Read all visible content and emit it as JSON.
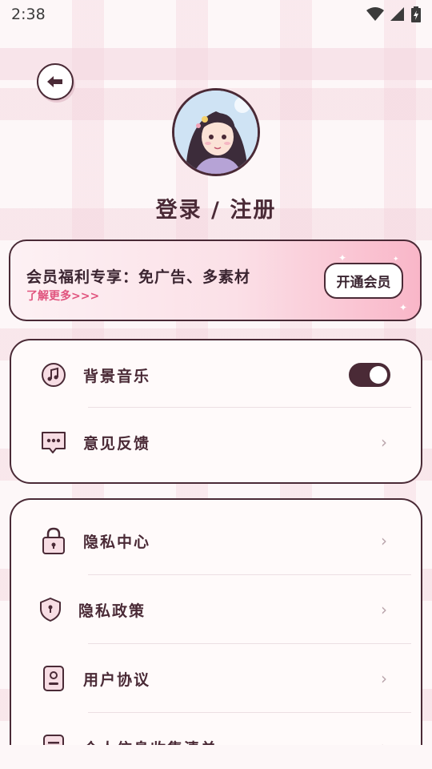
{
  "status": {
    "time": "2:38"
  },
  "profile": {
    "login_text": "登录 / 注册"
  },
  "vip": {
    "title": "会员福利专享：免广告、多素材",
    "more": "了解更多>>>",
    "button": "开通会员"
  },
  "settings_group_1": [
    {
      "label": "背景音乐",
      "icon": "music-note-icon",
      "control": "toggle",
      "toggle_on": true
    },
    {
      "label": "意见反馈",
      "icon": "chat-bubble-icon",
      "control": "chevron"
    }
  ],
  "settings_group_2": [
    {
      "label": "隐私中心",
      "icon": "lock-icon"
    },
    {
      "label": "隐私政策",
      "icon": "shield-icon"
    },
    {
      "label": "用户协议",
      "icon": "user-card-icon"
    },
    {
      "label": "个人信息收集清单",
      "icon": "list-document-icon"
    }
  ],
  "chevron": "›",
  "colors": {
    "accent": "#4a2a36",
    "pink": "#f9b6c8",
    "link": "#e0547e"
  }
}
